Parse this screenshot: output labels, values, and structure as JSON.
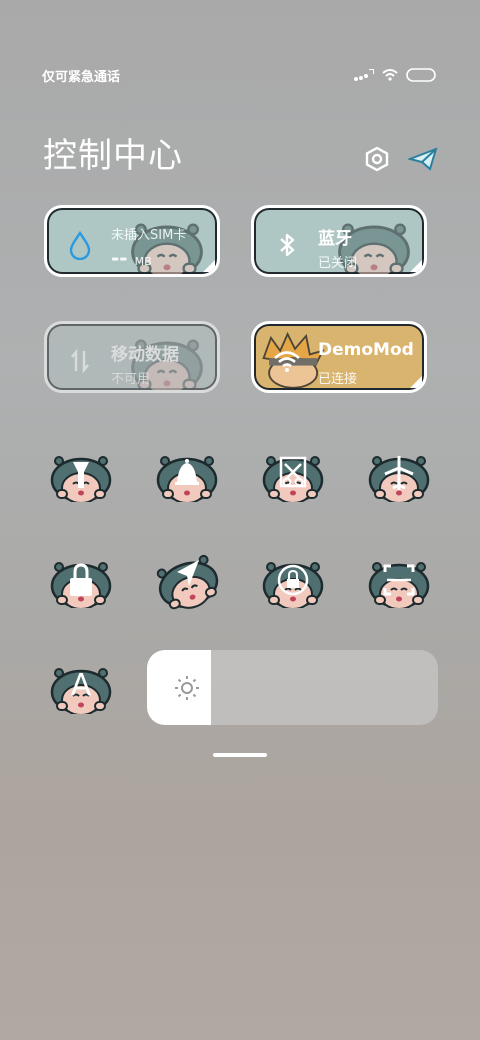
{
  "status_bar": {
    "carrier_text": "仅可紧急通话",
    "icons": [
      "signal-icon",
      "wifi-icon",
      "battery-icon"
    ]
  },
  "header": {
    "title": "控制中心",
    "icons": [
      "settings-icon",
      "edit-icon"
    ]
  },
  "tiles": [
    {
      "name": "mobile-data-usage",
      "label": "未插入SIM卡",
      "value": "--",
      "unit": "MB",
      "icon": "water-drop-icon",
      "state": "on"
    },
    {
      "name": "bluetooth",
      "label": "蓝牙",
      "sub": "已关闭",
      "icon": "bluetooth-icon",
      "state": "off"
    },
    {
      "name": "mobile-data",
      "label": "移动数据",
      "sub": "不可用",
      "icon": "data-arrows-icon",
      "state": "disabled"
    },
    {
      "name": "wifi",
      "label": "DemoMod",
      "sub": "已连接",
      "icon": "wifi-icon",
      "state": "on"
    }
  ],
  "toggles": [
    {
      "icon": "flashlight-icon"
    },
    {
      "icon": "bell-icon"
    },
    {
      "icon": "screenshot-icon"
    },
    {
      "icon": "airplane-icon"
    },
    {
      "icon": "lock-icon"
    },
    {
      "icon": "location-icon"
    },
    {
      "icon": "rotation-lock-icon"
    },
    {
      "icon": "scanner-icon"
    },
    {
      "icon": "auto-brightness-icon",
      "glyph": "A"
    }
  ],
  "brightness": {
    "level": 0.22,
    "icon": "sun-icon"
  },
  "colors": {
    "tile_teal": "#aec6c4",
    "tile_wifi_on": "#d9b46e",
    "mascot_teal": "#4f6f70",
    "mascot_face": "#f2c9bd"
  }
}
